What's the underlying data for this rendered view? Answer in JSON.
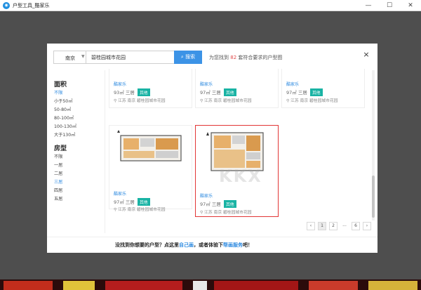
{
  "window": {
    "title": "户型工具_酷家乐",
    "min_label": "—",
    "max_label": "☐",
    "close_label": "✕"
  },
  "dialog": {
    "close_label": "×",
    "search": {
      "city": "南京",
      "keyword": "碧桂园城市花园",
      "button_label": "搜索",
      "found_prefix": "为您找到",
      "found_count": "82",
      "found_suffix": "套符合要求的户型图"
    },
    "filters": {
      "area_title": "面积",
      "area_items": [
        "不限",
        "小于50㎡",
        "50-80㎡",
        "80-100㎡",
        "100-130㎡",
        "大于130㎡"
      ],
      "area_active": 0,
      "room_title": "房型",
      "room_items": [
        "不限",
        "一居",
        "二居",
        "三居",
        "四居",
        "五居"
      ],
      "room_active": 3
    },
    "cards": [
      {
        "source": "酷家乐",
        "area": "93㎡",
        "rooms": "三居",
        "tag": "其他",
        "location": "江苏 南京",
        "community": "碧桂园城市花园"
      },
      {
        "source": "酷家乐",
        "area": "97㎡",
        "rooms": "三居",
        "tag": "其他",
        "location": "江苏 南京",
        "community": "碧桂园城市花园"
      },
      {
        "source": "酷家乐",
        "area": "97㎡",
        "rooms": "三居",
        "tag": "其他",
        "location": "江苏 南京",
        "community": "碧桂园城市花园"
      },
      {
        "source": "酷家乐",
        "area": "97㎡",
        "rooms": "三居",
        "tag": "其他",
        "location": "江苏 南京",
        "community": "碧桂园城市花园"
      },
      {
        "source": "酷家乐",
        "area": "97㎡",
        "rooms": "三居",
        "tag": "其他",
        "location": "江苏 南京",
        "community": "碧桂园城市花园"
      }
    ],
    "pagination": {
      "prev": "‹",
      "pages": [
        "1",
        "2",
        "...",
        "6"
      ],
      "next": "›",
      "current": 0
    },
    "footer": {
      "text1": "没找到你想要的户型？点这里",
      "link1": "自己画",
      "text2": "，或者体验下",
      "link2": "帮画服务",
      "text3": "吧！"
    },
    "watermark": "KKX"
  }
}
